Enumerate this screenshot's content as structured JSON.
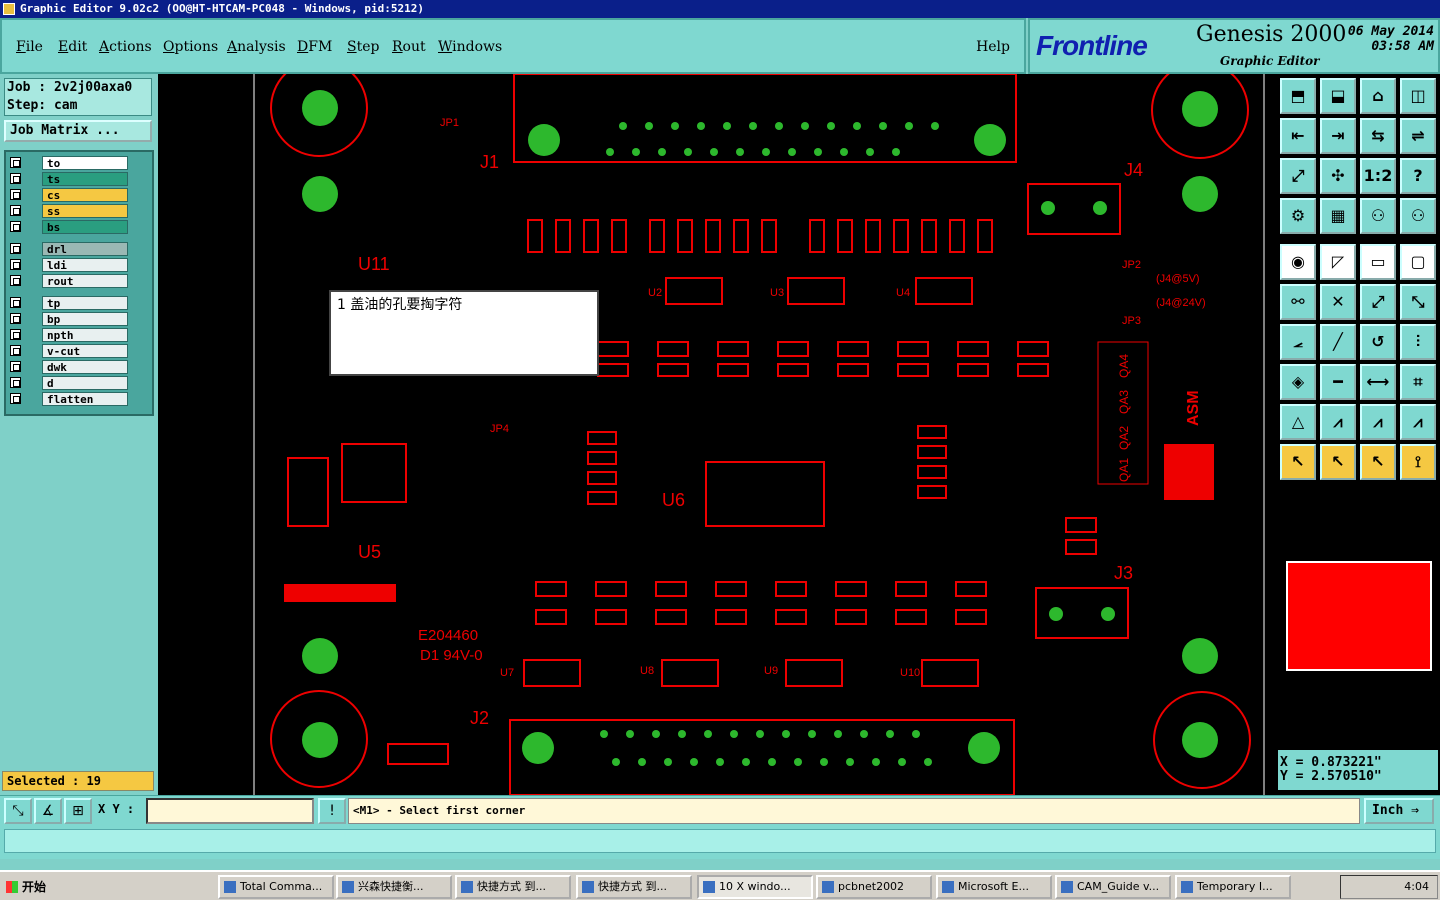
{
  "window": {
    "title": "Graphic Editor 9.02c2 (OO@HT-HTCAM-PC048 - Windows, pid:5212)"
  },
  "menu": [
    "File",
    "Edit",
    "Actions",
    "Options",
    "Analysis",
    "DFM",
    "Step",
    "Rout",
    "Windows"
  ],
  "help_label": "Help",
  "brand": {
    "logo": "Frontline",
    "product": "Genesis 2000",
    "subtitle": "Graphic Editor",
    "date": "06 May 2014",
    "time": "03:58 AM"
  },
  "job": {
    "job_line": "Job : 2v2j00axa0",
    "step_line": "Step: cam",
    "matrix_button": "Job Matrix ..."
  },
  "layers": [
    {
      "name": "to",
      "color": "#ffffff"
    },
    {
      "name": "ts",
      "color": "#2a9e80"
    },
    {
      "name": "cs",
      "color": "#f5c842"
    },
    {
      "name": "ss",
      "color": "#f5c842"
    },
    {
      "name": "bs",
      "color": "#2a9e80"
    },
    {
      "name": "drl",
      "color": "#9ab8b4"
    },
    {
      "name": "ldi",
      "color": "#e8f0f0"
    },
    {
      "name": "rout",
      "color": "#e8f0f0"
    },
    {
      "name": "tp",
      "color": "#e8f0f0"
    },
    {
      "name": "bp",
      "color": "#e8f0f0"
    },
    {
      "name": "npth",
      "color": "#e8f0f0"
    },
    {
      "name": "v-cut",
      "color": "#e8f0f0"
    },
    {
      "name": "dwk",
      "color": "#e8f0f0"
    },
    {
      "name": "d",
      "color": "#e8f0f0"
    },
    {
      "name": "flatten",
      "color": "#e8f0f0"
    }
  ],
  "selected": "Selected : 19",
  "note_text": "1 盖油的孔要掏字符",
  "pcb_labels": {
    "j1": "J1",
    "j2": "J2",
    "j3": "J3",
    "j4": "J4",
    "jp1": "JP1",
    "jp2": "JP2",
    "jp3": "JP3",
    "jp4": "JP4",
    "u5": "U5",
    "u6": "U6",
    "u11": "U11",
    "u2": "U2",
    "u3": "U3",
    "u4": "U4",
    "u7": "U7",
    "u8": "U8",
    "u9": "U9",
    "u10": "U10",
    "e204460": "E204460",
    "d1_94v0": "D1  94V-0",
    "asm": "ASM",
    "j4_5v": "(J4@5V)",
    "j4_24v": "(J4@24V)",
    "qa": [
      "QA4",
      "QA3",
      "QA2",
      "QA1"
    ]
  },
  "coords": {
    "x": "X = 0.873221\"",
    "y": "Y = 2.570510\""
  },
  "cmd": {
    "xy_label": "X Y :",
    "prompt": "<M1> - Select first corner",
    "units": "Inch"
  },
  "taskbar": {
    "start": "开始",
    "items": [
      "Total Comma...",
      "兴森快捷衡...",
      "快捷方式 到...",
      "快捷方式 到...",
      "10 X windo...",
      "pcbnet2002",
      "Microsoft E...",
      "CAM_Guide v...",
      "Temporary I..."
    ],
    "clock": "4:04"
  }
}
